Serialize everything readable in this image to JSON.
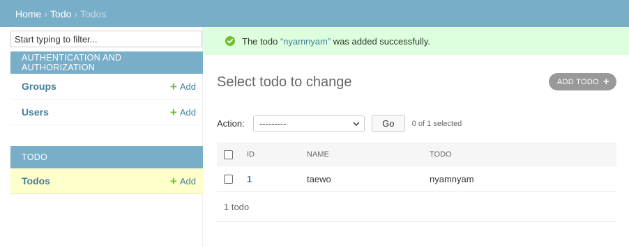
{
  "breadcrumb": {
    "home": "Home",
    "app": "Todo",
    "current": "Todos",
    "separator": "›"
  },
  "sidebar": {
    "filter_placeholder": "Start typing to filter...",
    "modules": [
      {
        "caption": "AUTHENTICATION AND AUTHORIZATION",
        "items": [
          {
            "label": "Groups",
            "add": "Add"
          },
          {
            "label": "Users",
            "add": "Add"
          }
        ]
      },
      {
        "caption": "TODO",
        "items": [
          {
            "label": "Todos",
            "add": "Add",
            "current": true
          }
        ]
      }
    ]
  },
  "message": {
    "prefix": "The todo ",
    "link": "“nyamnyam”",
    "suffix": " was added successfully.",
    "icon": "check-circle-icon"
  },
  "main": {
    "title": "Select todo to change",
    "add_button": "ADD TODO",
    "action_label": "Action:",
    "action_value": "---------",
    "go_label": "Go",
    "selected_text": "0 of 1 selected",
    "columns": [
      "ID",
      "NAME",
      "TODO"
    ],
    "rows": [
      {
        "id": "1",
        "name": "taewo",
        "todo": "nyamnyam"
      }
    ],
    "paginator": "1 todo"
  },
  "colors": {
    "header": "#79aec8",
    "link": "#447e9b",
    "add_plus": "#70bf2b",
    "success_bg": "#ddffdd",
    "current_row": "#ffffcc"
  }
}
